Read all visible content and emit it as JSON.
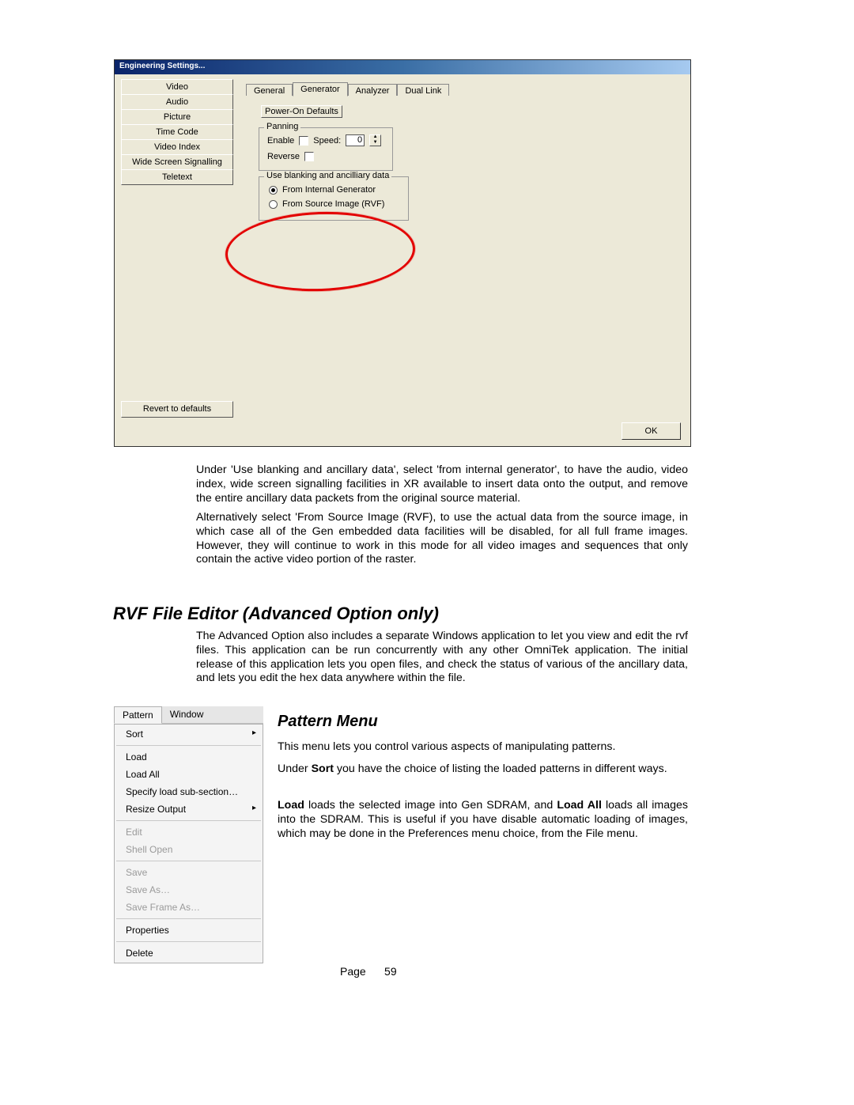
{
  "dlg": {
    "title": "Engineering Settings...",
    "sidebar": [
      "Video",
      "Audio",
      "Picture",
      "Time Code",
      "Video Index",
      "Wide Screen Signalling",
      "Teletext"
    ],
    "revert": "Revert to defaults",
    "tabs": [
      "General",
      "Generator",
      "Analyzer",
      "Dual Link"
    ],
    "active_tab": 1,
    "power_on": "Power-On Defaults",
    "panning_legend": "Panning",
    "enable_label": "Enable",
    "speed_label": "Speed:",
    "speed_value": "0",
    "reverse_label": "Reverse",
    "anc_legend": "Use blanking and ancilliary data",
    "radio1": "From Internal Generator",
    "radio2": "From Source Image (RVF)",
    "radio_checked": 0,
    "ok": "OK"
  },
  "text": {
    "p1": "Under 'Use blanking and ancillary data', select 'from internal generator', to have the audio, video index, wide screen signalling facilities in XR available to insert data onto the output, and remove the entire ancillary data packets from the original source material.",
    "p2": "Alternatively select 'From Source Image (RVF), to use the actual data from the source image, in which case all of the Gen embedded data facilities will be disabled, for all full frame images.  However, they will continue to work in this mode for all video images and sequences that only contain the active video portion of the raster.",
    "h1": "RVF File Editor (Advanced Option only)",
    "p3": "The Advanced Option also includes a separate Windows application to let you view and edit the rvf files.  This application can be run concurrently with any other OmniTek application.  The initial release of this application lets you open files, and check the status of various of the ancillary data, and lets you edit the hex data anywhere within the file.",
    "h2": "Pattern Menu",
    "p4": "This menu lets you control various aspects of manipulating patterns.",
    "p5_pre": "Under ",
    "p5_b": "Sort",
    "p5_post": " you have the choice of listing the loaded patterns in different ways.",
    "p6_1b": "Load",
    "p6_1": " loads the selected image into Gen SDRAM, and ",
    "p6_2b": "Load All",
    "p6_2": " loads all images into the SDRAM.  This is useful if you have disable automatic loading of images, which may be done in the Preferences menu choice, from the File menu."
  },
  "menu": {
    "bar": [
      "Pattern",
      "Window"
    ],
    "items": [
      {
        "label": "Sort",
        "sub": true
      },
      {
        "sep": true
      },
      {
        "label": "Load"
      },
      {
        "label": "Load All"
      },
      {
        "label": "Specify load sub-section…"
      },
      {
        "label": "Resize Output",
        "sub": true
      },
      {
        "sep": true
      },
      {
        "label": "Edit",
        "disabled": true
      },
      {
        "label": "Shell Open",
        "disabled": true
      },
      {
        "sep": true
      },
      {
        "label": "Save",
        "disabled": true
      },
      {
        "label": "Save As…",
        "disabled": true
      },
      {
        "label": "Save Frame As…",
        "disabled": true
      },
      {
        "sep": true
      },
      {
        "label": "Properties"
      },
      {
        "sep": true
      },
      {
        "label": "Delete"
      }
    ]
  },
  "footer": {
    "page_label": "Page",
    "page_num": "59"
  }
}
